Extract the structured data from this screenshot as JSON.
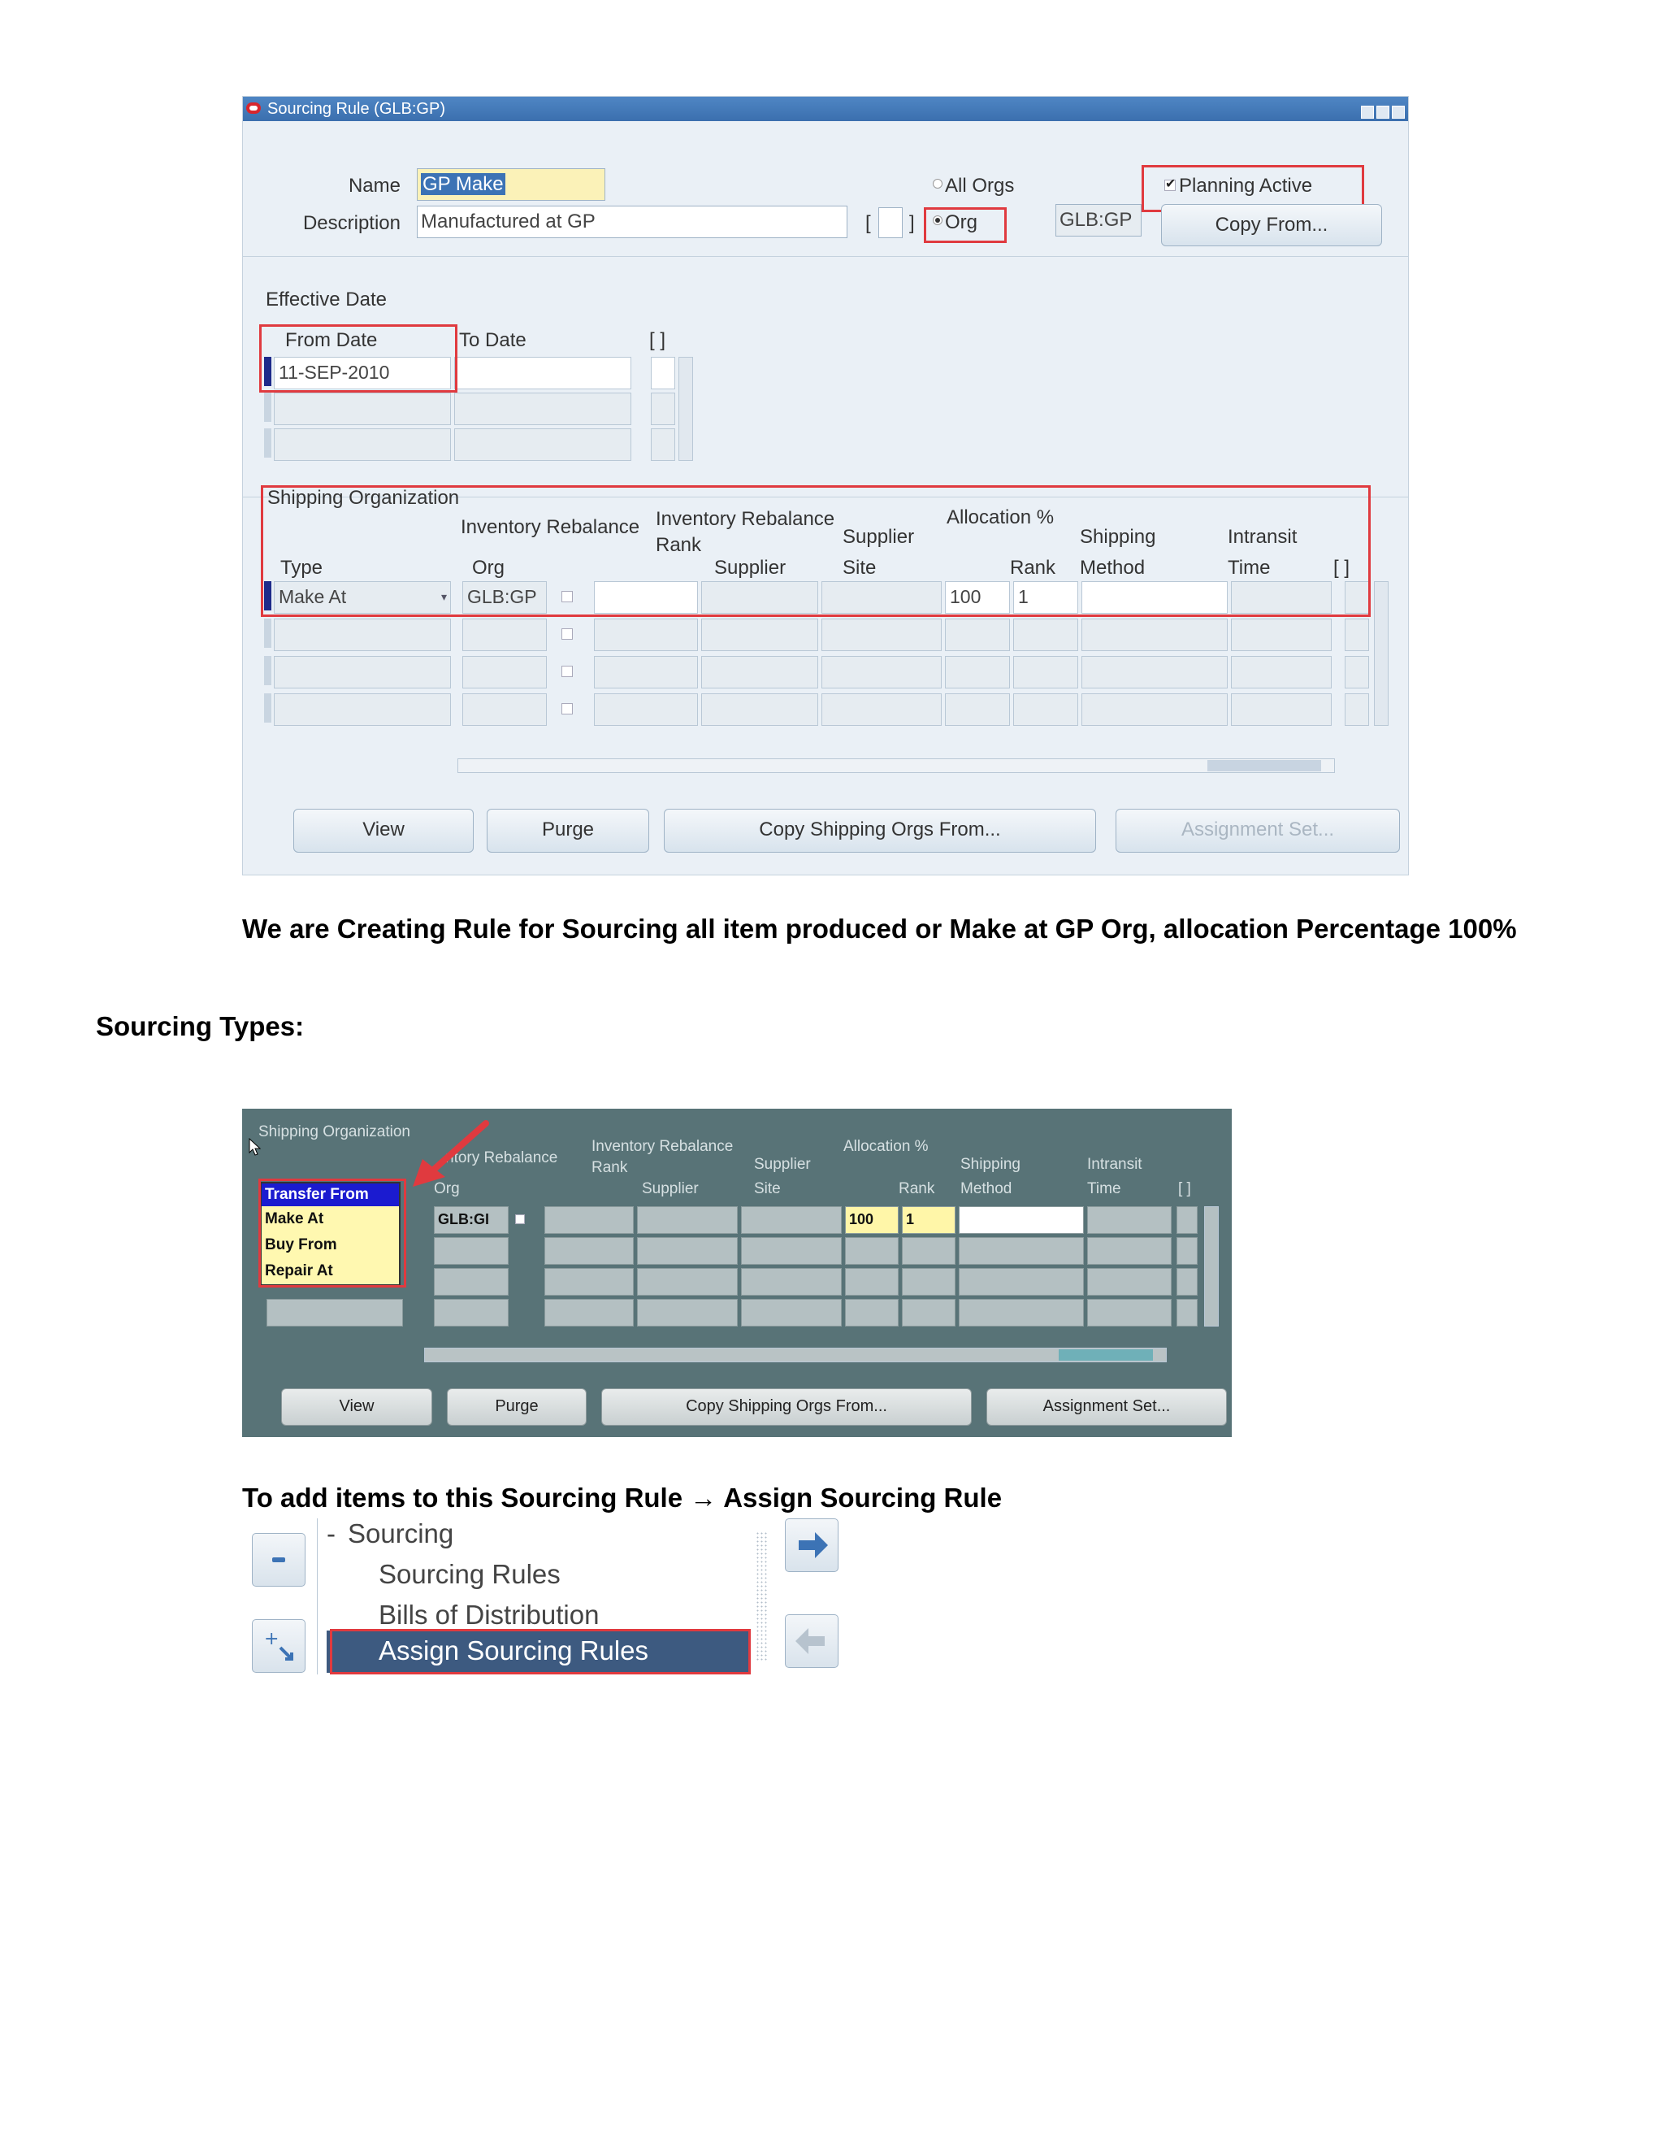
{
  "window1": {
    "title": "Sourcing Rule (GLB:GP)",
    "name_label": "Name",
    "name_value": "GP Make",
    "description_label": "Description",
    "description_value": "Manufactured at GP",
    "bracket_a": "[",
    "bracket_b": "]",
    "all_orgs_label": "All Orgs",
    "org_label": "Org",
    "org_value": "GLB:GP",
    "planning_active_label": "Planning Active",
    "planning_active": true,
    "copy_from_button": "Copy From...",
    "effective_date_label": "Effective Date",
    "from_date_label": "From Date",
    "to_date_label": "To Date",
    "date_brackets": "[ ]",
    "from_date_value": "11-SEP-2010",
    "shipping_org_label": "Shipping Organization",
    "columns": {
      "type": "Type",
      "inv_rebalance": "Inventory Rebalance",
      "org": "Org",
      "inv_rebalance_rank_1": "Inventory Rebalance",
      "inv_rebalance_rank_2": "Rank",
      "supplier": "Supplier",
      "supplier_site_1": "Supplier",
      "supplier_site_2": "Site",
      "allocation": "Allocation %",
      "rank": "Rank",
      "shipping_method_1": "Shipping",
      "shipping_method_2": "Method",
      "intransit_1": "Intransit",
      "intransit_2": "Time",
      "brackets": "[ ]"
    },
    "row1": {
      "type": "Make At",
      "org": "GLB:GP",
      "allocation": "100",
      "rank": "1"
    },
    "buttons": {
      "view": "View",
      "purge": "Purge",
      "copy_shipping": "Copy Shipping Orgs From...",
      "assignment_set": "Assignment Set..."
    }
  },
  "text": {
    "caption": "We are Creating Rule for Sourcing all item produced or Make at GP Org, allocation Percentage 100%",
    "sourcing_types": "Sourcing Types:",
    "assign_line": "To add items to this Sourcing Rule → Assign Sourcing Rule"
  },
  "window2": {
    "shipping_org_label": "Shipping Organization",
    "columns": {
      "inv_rebalance": "ntory Rebalance",
      "org": "Org",
      "inv_rebalance_rank_1": "Inventory Rebalance",
      "inv_rebalance_rank_2": "Rank",
      "supplier": "Supplier",
      "supplier_site_1": "Supplier",
      "supplier_site_2": "Site",
      "allocation": "Allocation %",
      "rank": "Rank",
      "shipping_method_1": "Shipping",
      "shipping_method_2": "Method",
      "intransit_1": "Intransit",
      "intransit_2": "Time",
      "brackets": "[ ]"
    },
    "type_options": [
      "Transfer From",
      "Make At",
      "Buy From",
      "Repair At"
    ],
    "row1": {
      "org": "GLB:GI",
      "allocation": "100",
      "rank": "1"
    },
    "buttons": {
      "view": "View",
      "purge": "Purge",
      "copy_shipping": "Copy Shipping Orgs From...",
      "assignment_set": "Assignment Set..."
    }
  },
  "window3": {
    "tree_dash": "-",
    "sourcing": "Sourcing",
    "sourcing_rules": "Sourcing Rules",
    "bills_of_distribution": "Bills of Distribution",
    "assign_sourcing_rules": "Assign Sourcing Rules"
  },
  "colors": {
    "highlight_red": "#e03a3f",
    "title_blue": "#3b6fae",
    "dark_panel": "#587377",
    "nav_selected": "#3d5a80"
  }
}
